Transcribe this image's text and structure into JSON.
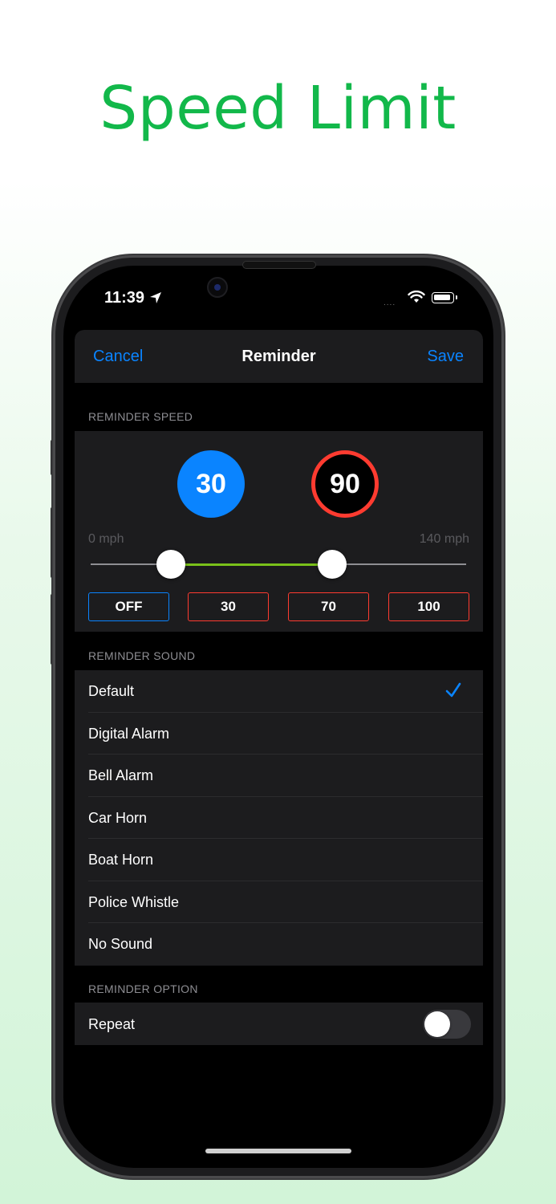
{
  "headline": "Speed Limit",
  "status_bar": {
    "time": "11:39",
    "signal_dots": "....",
    "icons": [
      "location-arrow-icon",
      "wifi-icon",
      "battery-icon"
    ]
  },
  "navbar": {
    "cancel_label": "Cancel",
    "title": "Reminder",
    "save_label": "Save"
  },
  "reminder_speed": {
    "header": "REMINDER SPEED",
    "current_speed": "30",
    "limit_speed": "90",
    "range_min_label": "0 mph",
    "range_max_label": "140 mph",
    "range_min": 0,
    "range_max": 140,
    "slider_low_value": 30,
    "slider_high_value": 90,
    "presets": [
      "OFF",
      "30",
      "70",
      "100"
    ]
  },
  "reminder_sound": {
    "header": "REMINDER SOUND",
    "options": [
      "Default",
      "Digital Alarm",
      "Bell Alarm",
      "Car Horn",
      "Boat Horn",
      "Police Whistle",
      "No Sound"
    ],
    "selected": "Default"
  },
  "reminder_option": {
    "header": "REMINDER OPTION",
    "repeat_label": "Repeat",
    "repeat_on": false
  },
  "colors": {
    "accent": "#0a84ff",
    "limit_red": "#ff3b30",
    "range_green": "#7ac11a",
    "headline_green": "#12b84a"
  }
}
